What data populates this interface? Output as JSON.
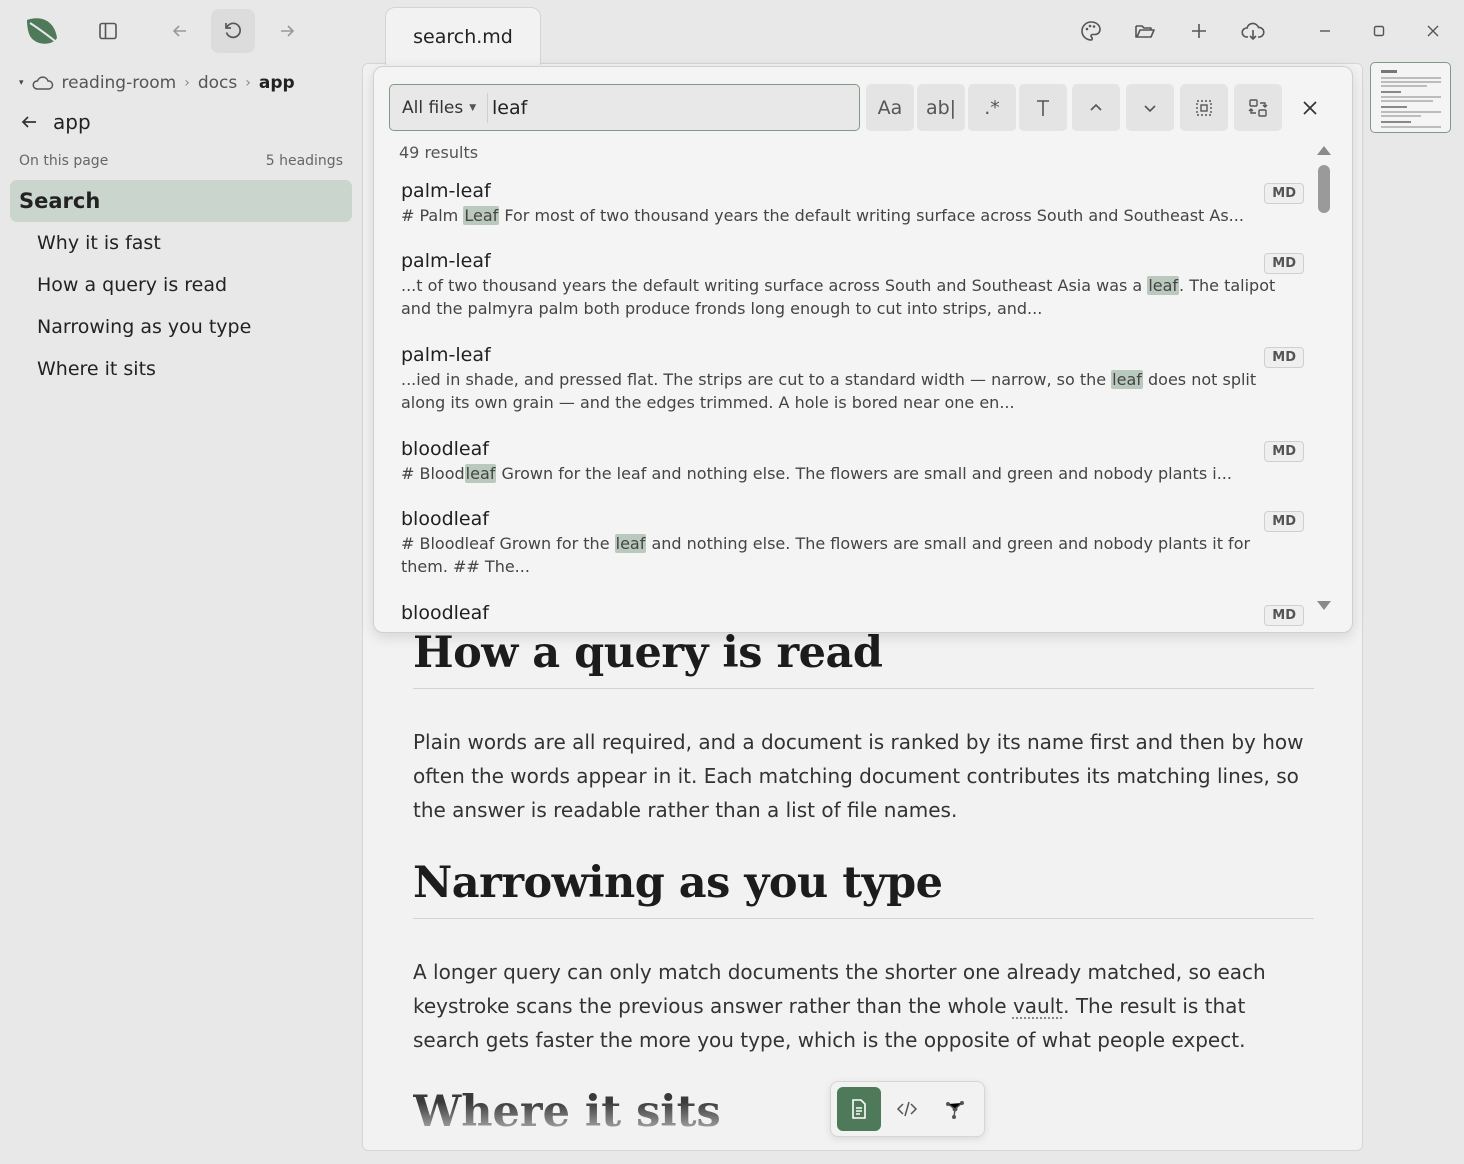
{
  "tab": {
    "title": "search.md"
  },
  "breadcrumb": {
    "items": [
      "reading-room",
      "docs",
      "app"
    ]
  },
  "sidebar": {
    "back_label": "app",
    "on_this_page": "On this page",
    "heading_count": "5 headings",
    "headings": [
      {
        "label": "Search",
        "level": 1,
        "selected": true
      },
      {
        "label": "Why it is fast",
        "level": 2
      },
      {
        "label": "How a query is read",
        "level": 2
      },
      {
        "label": "Narrowing as you type",
        "level": 2
      },
      {
        "label": "Where it sits",
        "level": 2
      }
    ]
  },
  "search": {
    "scope": "All files",
    "query": "leaf",
    "result_count": "49 results",
    "toggles": [
      "Aa",
      "ab|",
      ".*"
    ],
    "results": [
      {
        "name": "palm-leaf",
        "badge": "MD",
        "pre": "# Palm ",
        "hit": "Leaf",
        "post": " For most of two thousand years the default writing surface across South and Southeast As..."
      },
      {
        "name": "palm-leaf",
        "badge": "MD",
        "pre": "...t of two thousand years the default writing surface across South and Southeast Asia was a ",
        "hit": "leaf",
        "post": ". The talipot and the palmyra palm both produce fronds long enough to cut into strips, and..."
      },
      {
        "name": "palm-leaf",
        "badge": "MD",
        "pre": "...ied in shade, and pressed flat. The strips are cut to a standard width — narrow, so the ",
        "hit": "leaf",
        "post": " does not split along its own grain — and the edges trimmed. A hole is bored near one en..."
      },
      {
        "name": "bloodleaf",
        "badge": "MD",
        "pre": "# Blood",
        "hit": "leaf",
        "post": " Grown for the leaf and nothing else. The flowers are small and green and nobody plants i..."
      },
      {
        "name": "bloodleaf",
        "badge": "MD",
        "pre": "# Bloodleaf Grown for the ",
        "hit": "leaf",
        "post": " and nothing else. The flowers are small and green and nobody plants it for them. ## The..."
      },
      {
        "name": "bloodleaf",
        "badge": "MD",
        "pre": "",
        "hit": "",
        "post": ""
      }
    ]
  },
  "doc": {
    "h_query": "How a query is read",
    "p_query": "Plain words are all required, and a document is ranked by its name first and then by how often the words appear in it. Each matching document contributes its matching lines, so the answer is readable rather than a list of file names.",
    "h_narrow": "Narrowing as you type",
    "p_narrow_a": "A longer query can only match documents the shorter one already matched, so each keystroke scans the previous answer rather than the whole ",
    "p_narrow_link": "vault",
    "p_narrow_b": ". The result is that search gets faster the more you type, which is the opposite of what people expect.",
    "h_where": "Where it sits"
  },
  "colors": {
    "accent": "#4e7a59",
    "highlight": "#b9c9bd",
    "selection": "#c9d5cd"
  }
}
